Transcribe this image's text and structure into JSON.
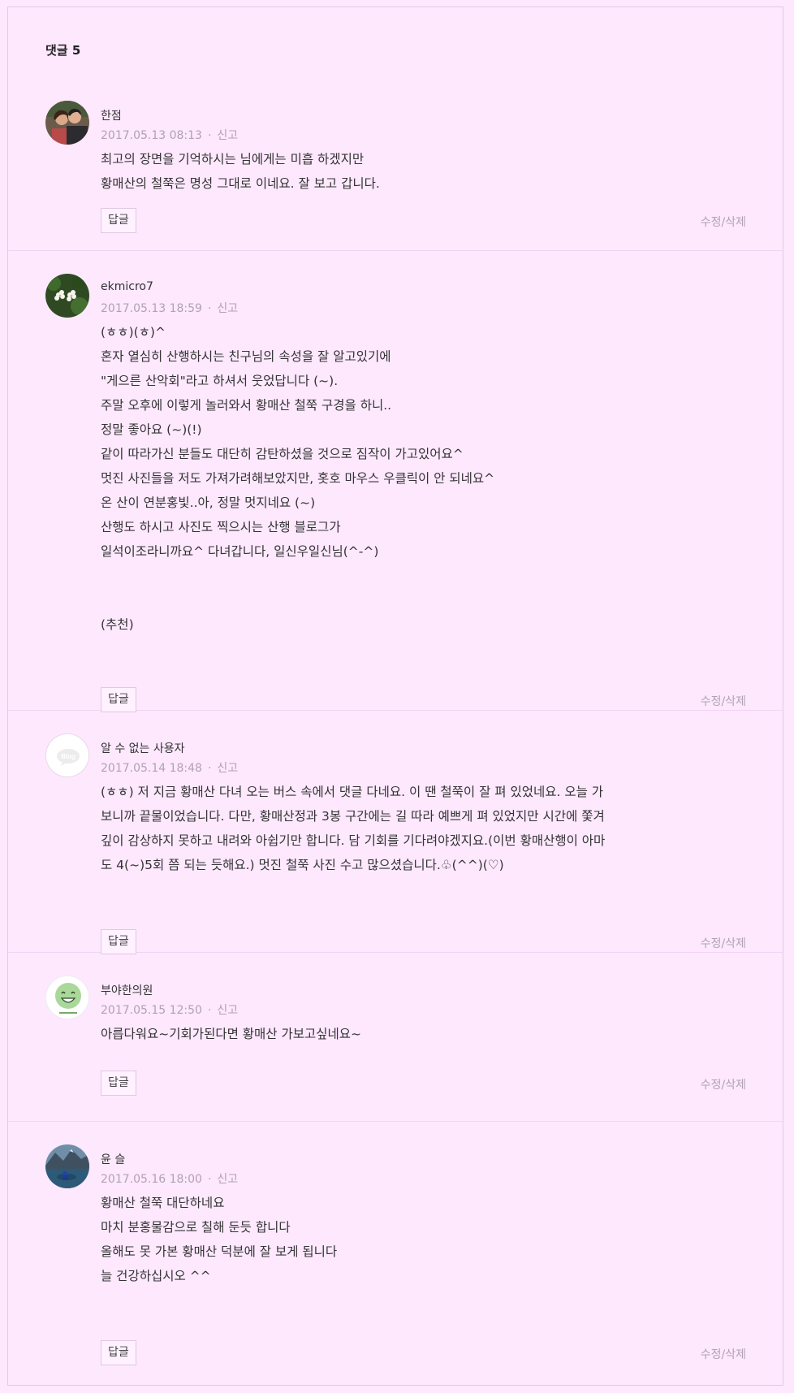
{
  "section_title": "댓글 5",
  "comments": [
    {
      "author": "한점",
      "date": "2017.05.13 08:13",
      "separator": "·",
      "report_label": "신고",
      "lines": [
        "최고의 장면을 기억하시는 님에게는 미흡 하겠지만",
        "황매산의 철쭉은 명성 그대로 이네요. 잘 보고 갑니다."
      ],
      "reply_label": "답글",
      "edit_label": "수정/삭제",
      "avatar_icon": "couple-photo-avatar"
    },
    {
      "author": "ekmicro7",
      "date": "2017.05.13 18:59",
      "separator": "·",
      "report_label": "신고",
      "lines": [
        "(ㅎㅎ)(ㅎ)^",
        "혼자 열심히 산행하시는 친구님의 속성을 잘 알고있기에",
        "\"게으른 산악회\"라고 하셔서 웃었답니다 (~).",
        "주말 오후에 이렇게 놀러와서 황매산 철쭉 구경을 하니..",
        "정말 좋아요 (~)(!)",
        "같이 따라가신 분들도 대단히 감탄하셨을 것으로 짐작이 가고있어요^",
        "멋진 사진들을 저도 가져가려해보았지만, 홋호 마우스 우클릭이 안 되네요^",
        "온 산이 연분홍빛..아, 정말 멋지네요 (~)",
        "산행도 하시고 사진도 찍으시는 산행 블로그가",
        "일석이조라니까요^ 다녀갑니다, 일신우일신님(^-^)",
        "",
        "",
        "(추천)"
      ],
      "reply_label": "답글",
      "edit_label": "수정/삭제",
      "avatar_icon": "white-flowers-avatar"
    },
    {
      "author": "알 수 없는 사용자",
      "date": "2017.05.14 18:48",
      "separator": "·",
      "report_label": "신고",
      "lines": [
        "(ㅎㅎ) 저 지금 황매산 다녀 오는 버스 속에서 댓글 다네요. 이 땐 철쭉이 잘 펴 있었네요. 오늘 가",
        "보니까 끝물이었습니다. 다만, 황매산정과 3봉 구간에는 길 따라 예쁘게 펴 있었지만 시간에 쫓겨",
        "깊이 감상하지 못하고 내려와 아쉽기만 합니다. 담 기회를 기다려야겠지요.(이번 황매산행이 아마",
        "도 4(~)5회 쯤 되는 듯해요.) 멋진 철쭉 사진 수고 많으셨습니다.♧(^^)(♡)"
      ],
      "reply_label": "답글",
      "edit_label": "수정/삭제",
      "avatar_icon": "default-blog-avatar",
      "avatar_text": "Blog"
    },
    {
      "author": "부야한의원",
      "date": "2017.05.15 12:50",
      "separator": "·",
      "report_label": "신고",
      "lines": [
        "아릅다워요~기회가된다면 황매산 가보고싶네요~"
      ],
      "reply_label": "답글",
      "edit_label": "수정/삭제",
      "avatar_icon": "smiley-face-avatar"
    },
    {
      "author": "윤 슬",
      "date": "2017.05.16 18:00",
      "separator": "·",
      "report_label": "신고",
      "lines": [
        "황매산 철쭉 대단하네요",
        "마치 분홍물감으로 칠해 둔듯 합니다",
        "올해도 못 가본 황매산 덕분에 잘 보게 됩니다",
        "늘 건강하십시오 ^^"
      ],
      "reply_label": "답글",
      "edit_label": "수정/삭제",
      "avatar_icon": "mountain-lake-avatar"
    }
  ]
}
